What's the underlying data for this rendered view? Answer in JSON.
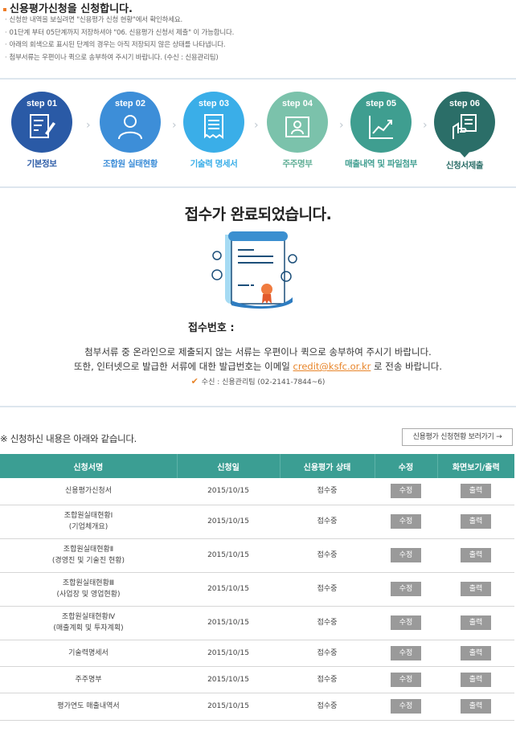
{
  "notice": {
    "title": "신용평가신청을 신청합니다.",
    "lines": [
      "신청한 내역을 보실려면 \"신용평가 신청 현황\"에서 확인하세요.",
      "01단계 부터 05단계까지 저장하셔야 \"06. 신용평가 신청서 제출\" 이 가능합니다.",
      "아래의 회색으로 표시된 단계의 경우는 아직 저장되지 않은 상태를 나타냅니다.",
      "첨부서류는 우편이나 퀵으로 송부하여 주시기 바랍니다. (수신 : 신용관리팀)"
    ]
  },
  "steps": [
    {
      "label": "step 01",
      "name": "기본정보",
      "color": "#2a5aa6",
      "icon": "document-pen-icon"
    },
    {
      "label": "step 02",
      "name": "조합원 실태현황",
      "color": "#3d8ed8",
      "icon": "users-icon"
    },
    {
      "label": "step 03",
      "name": "기술력 명세서",
      "color": "#3aaee8",
      "icon": "receipt-icon"
    },
    {
      "label": "step 04",
      "name": "주주명부",
      "color": "#7bc2ab",
      "icon": "id-card-icon"
    },
    {
      "label": "step 05",
      "name": "매출내역 및 파일첨부",
      "color": "#3f9e90",
      "icon": "chart-icon"
    },
    {
      "label": "step 06",
      "name": "신청서제출",
      "color": "#2b6e68",
      "icon": "hand-document-icon"
    }
  ],
  "complete": {
    "title": "접수가 완료되었습니다.",
    "receipt_label": "접수번호 :",
    "desc_line1": "첨부서류 중 온라인으로 제출되지 않는 서류는 우편이나 퀵으로 송부하여 주시기 바랍니다.",
    "desc_line2_pre": "또한, 인터넷으로 발급한 서류에 대한 발급번호는 이메일 ",
    "email": "credit@ksfc.or.kr",
    "desc_line2_post": " 로 전송 바랍니다.",
    "contact": "수신 : 신용관리팀 (02-2141-7844~6)"
  },
  "list": {
    "title": "※ 신청하신 내용은 아래와 같습니다.",
    "status_link": "신용평가 신청현황 보러가기 →",
    "headers": [
      "신청서명",
      "신청일",
      "신용평가 상태",
      "수정",
      "화면보기/출력"
    ],
    "edit_label": "수정",
    "print_label": "출력",
    "rows": [
      {
        "name1": "신용평가신청서",
        "name2": "",
        "date": "2015/10/15",
        "status": "접수중"
      },
      {
        "name1": "조합원실태현황Ⅰ",
        "name2": "(기업체개요)",
        "date": "2015/10/15",
        "status": "접수중"
      },
      {
        "name1": "조합원실태현황Ⅱ",
        "name2": "(경영진 및 기술진 현황)",
        "date": "2015/10/15",
        "status": "접수중"
      },
      {
        "name1": "조합원실태현황Ⅲ",
        "name2": "(사업장 및 영업현황)",
        "date": "2015/10/15",
        "status": "접수중"
      },
      {
        "name1": "조합원실태현황Ⅳ",
        "name2": "(매출계획 및 투자계획)",
        "date": "2015/10/15",
        "status": "접수중"
      },
      {
        "name1": "기술력명세서",
        "name2": "",
        "date": "2015/10/15",
        "status": "접수중"
      },
      {
        "name1": "주주명부",
        "name2": "",
        "date": "2015/10/15",
        "status": "접수중"
      },
      {
        "name1": "평가연도 매출내역서",
        "name2": "",
        "date": "2015/10/15",
        "status": "접수중"
      }
    ]
  }
}
